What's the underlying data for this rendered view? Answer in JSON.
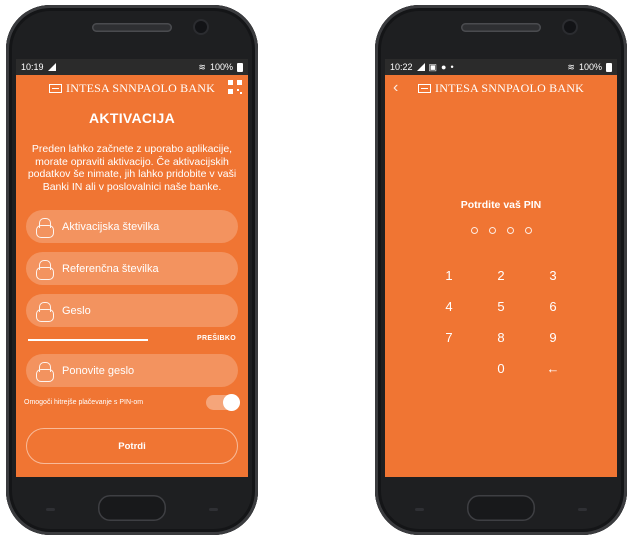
{
  "left_screen": {
    "status": {
      "time": "10:19",
      "battery": "100%"
    },
    "brand": "INTESA SNNPAOLO BANK",
    "title": "AKTIVACIJA",
    "intro": "Preden lahko začnete z uporabo aplikacije, morate opraviti aktivacijo. Če aktivacijskih podatkov še nimate, jih lahko pridobite v vaši Banki IN ali v poslovalnici naše banke.",
    "fields": {
      "activation_number": {
        "placeholder": "Aktivacijska številka",
        "icon": "lock-icon"
      },
      "reference_number": {
        "placeholder": "Referenčna številka",
        "icon": "lock-icon"
      },
      "password": {
        "placeholder": "Geslo",
        "icon": "lock-icon"
      },
      "repeat_password": {
        "placeholder": "Ponovite geslo",
        "icon": "lock-icon"
      }
    },
    "strength_label": "PREŠIBKO",
    "pin_toggle": {
      "label": "Omogoči hitrejše plačevanje s PIN-om",
      "on": true
    },
    "confirm_button": "Potrdi"
  },
  "right_screen": {
    "status": {
      "time": "10:22",
      "battery": "100%"
    },
    "brand": "INTESA SNNPAOLO BANK",
    "prompt": "Potrdite vaš PIN",
    "pin_length": 4,
    "keys": [
      "1",
      "2",
      "3",
      "4",
      "5",
      "6",
      "7",
      "8",
      "9",
      "",
      "0",
      "←"
    ]
  },
  "colors": {
    "accent": "#f07533",
    "statusbar": "#2b2b2b",
    "phone": "#1e1f21"
  }
}
